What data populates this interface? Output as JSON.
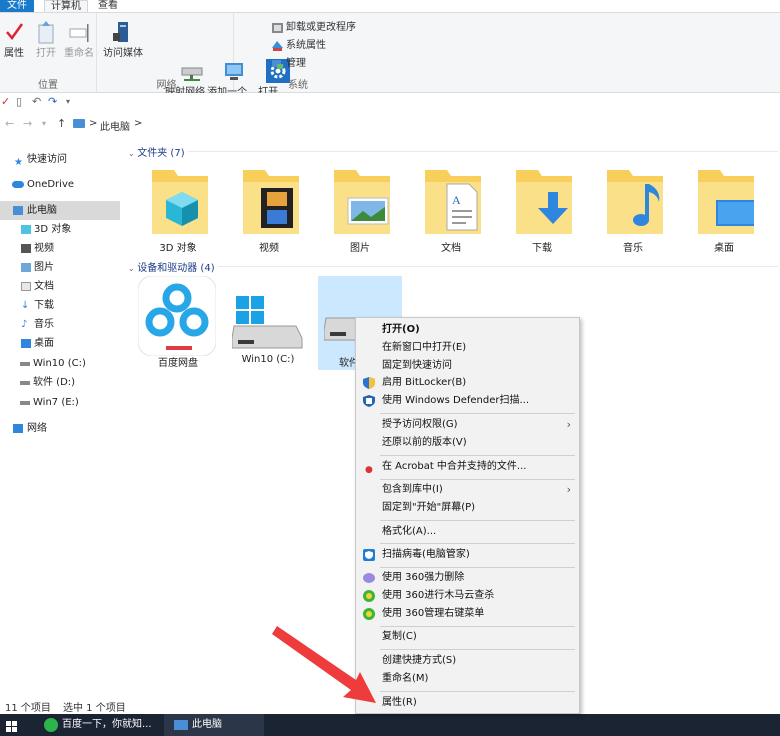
{
  "ribbon_tabs": [
    "文件",
    "计算机",
    "查看"
  ],
  "ribbon": {
    "location_group": {
      "label": "位置",
      "buttons": [
        "属性",
        "打开",
        "重命名"
      ]
    },
    "network_group": {
      "label": "网络",
      "buttons": [
        "访问媒体",
        "映射网络\n驱动器",
        "添加一个\n网络位置"
      ]
    },
    "system_group": {
      "label": "系统",
      "open_settings": "打开\n设置",
      "small_buttons": [
        "卸载或更改程序",
        "系统属性",
        "管理"
      ]
    }
  },
  "address": {
    "breadcrumb_sep": ">",
    "location": "此电脑"
  },
  "nav_pane": {
    "items": [
      "快速访问",
      "OneDrive",
      "此电脑",
      "3D 对象",
      "视频",
      "图片",
      "文档",
      "下载",
      "音乐",
      "桌面",
      "Win10 (C:)",
      "软件 (D:)",
      "Win7 (E:)",
      "网络"
    ]
  },
  "content": {
    "folders_header": "文件夹 (7)",
    "folders": [
      "3D 对象",
      "视频",
      "图片",
      "文档",
      "下载",
      "音乐",
      "桌面"
    ],
    "devices_header": "设备和驱动器 (4)",
    "drives": [
      "百度网盘",
      "Win10 (C:)",
      "软件"
    ]
  },
  "context_menu": {
    "items": [
      {
        "label": "打开(O)",
        "icon": ""
      },
      {
        "label": "在新窗口中打开(E)",
        "icon": ""
      },
      {
        "label": "固定到快速访问",
        "icon": ""
      },
      {
        "label": "启用 BitLocker(B)",
        "icon": "shield-icon"
      },
      {
        "label": "使用 Windows Defender扫描...",
        "icon": "defender-icon"
      },
      {
        "label": "授予访问权限(G)",
        "icon": ""
      },
      {
        "label": "还原以前的版本(V)",
        "icon": ""
      },
      {
        "label": "在 Acrobat 中合并支持的文件...",
        "icon": "acrobat-icon"
      },
      {
        "label": "包含到库中(I)",
        "icon": ""
      },
      {
        "label": "固定到\"开始\"屏幕(P)",
        "icon": ""
      },
      {
        "label": "格式化(A)...",
        "icon": ""
      },
      {
        "label": "扫描病毒(电脑管家)",
        "icon": "tencent-shield-icon"
      },
      {
        "label": "使用 360强力删除",
        "icon": "360-delete-icon"
      },
      {
        "label": "使用 360进行木马云查杀",
        "icon": "360-scan-icon"
      },
      {
        "label": "使用 360管理右键菜单",
        "icon": "360-menu-icon"
      },
      {
        "label": "复制(C)",
        "icon": ""
      },
      {
        "label": "创建快捷方式(S)",
        "icon": ""
      },
      {
        "label": "重命名(M)",
        "icon": ""
      },
      {
        "label": "属性(R)",
        "icon": ""
      }
    ]
  },
  "status_bar": {
    "item_count": "11 个项目",
    "selected": "选中 1 个项目"
  },
  "taskbar": {
    "browser_item": "百度一下，你就知...",
    "explorer_item": "此电脑"
  },
  "colors": {
    "accent": "#1979ca",
    "annotation_arrow": "#ee3b3b",
    "folder": "#f7cf5a"
  }
}
